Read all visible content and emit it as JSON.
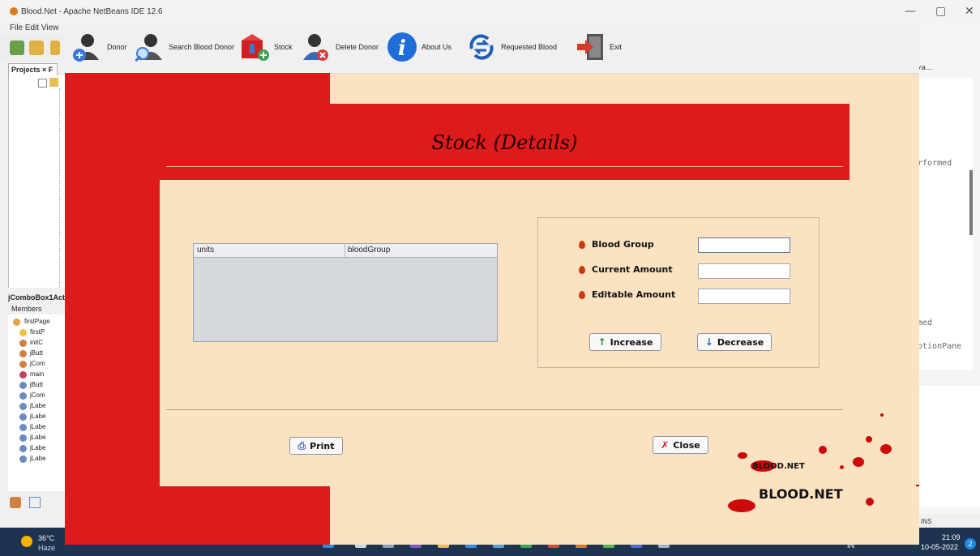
{
  "ide": {
    "title": "Blood.Net - Apache NetBeans IDE 12.6",
    "menu": "File  Edit  View",
    "projects_tab": "Projects ×  F",
    "navigator_title": "jComboBox1Act",
    "members_label": "Members",
    "members": [
      "firstPage",
      "firstP",
      "initC",
      "jButt",
      "jCom",
      "main",
      "jButt",
      "jCom",
      "jLabe",
      "jLabe",
      "jLabe",
      "jLabe",
      "jLabe",
      "jLabe"
    ],
    "right_tab": "va...",
    "right_code": [
      "rformed",
      "med",
      "ptionPane"
    ],
    "status_ins": "INS",
    "window_controls": [
      "—",
      "▢",
      "✕"
    ]
  },
  "taskbar": {
    "temp": "36°C",
    "weather": "Haze",
    "lang": "IN",
    "time": "21:09",
    "date": "10-05-2022",
    "badge": "2"
  },
  "app": {
    "toolbar": [
      {
        "id": "donor",
        "label": "Donor",
        "icon": "add-user-icon"
      },
      {
        "id": "search",
        "label": "Search Blood Donor",
        "icon": "search-user-icon"
      },
      {
        "id": "stock",
        "label": "Stock",
        "icon": "stock-box-icon"
      },
      {
        "id": "delete",
        "label": "Delete Donor",
        "icon": "delete-user-icon"
      },
      {
        "id": "about",
        "label": "About Us",
        "icon": "info-icon"
      },
      {
        "id": "requested",
        "label": "Requested Blood",
        "icon": "refresh-arrows-icon"
      },
      {
        "id": "exit",
        "label": "Exit",
        "icon": "exit-door-icon"
      }
    ],
    "page_title": "Stock (Details)",
    "table": {
      "columns": [
        "units",
        "bloodGroup"
      ],
      "rows": []
    },
    "form": {
      "blood_group_label": "Blood Group",
      "current_amount_label": "Current Amount",
      "editable_amount_label": "Editable Amount",
      "blood_group_value": "",
      "current_amount_value": "",
      "editable_amount_value": "",
      "increase_label": "Increase",
      "decrease_label": "Decrease"
    },
    "print_label": "Print",
    "close_label": "Close",
    "logo_small": "BLOOD.NET",
    "logo_large": "BLOOD.NET"
  },
  "colors": {
    "accent_red": "#dc1b1a",
    "background": "#fbe2c1"
  }
}
